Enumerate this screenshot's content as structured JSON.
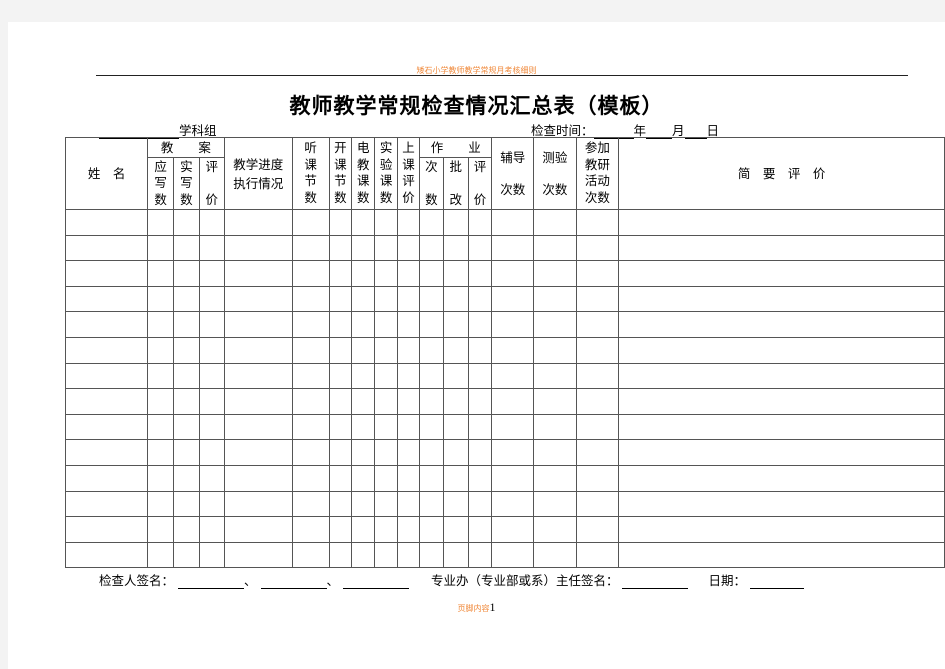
{
  "header_text": "矮石小学教师教学常规月考核细则",
  "title": "教师教学常规检查情况汇总表（模板）",
  "subject_group_label": "学科组",
  "check_time": {
    "label": "检查时间：",
    "year": "年",
    "month": "月",
    "day": "日"
  },
  "table": {
    "headers": {
      "name": "姓　名",
      "lesson_plan": "教　　案",
      "lesson_plan_sub": [
        {
          "chars": [
            "应",
            "写",
            "数"
          ]
        },
        {
          "chars": [
            "实",
            "写",
            "数"
          ]
        },
        {
          "chars": [
            "评",
            "",
            "价"
          ]
        }
      ],
      "progress": [
        "教学进度",
        "执行情况"
      ],
      "listen": [
        "听",
        "课",
        "节",
        "数"
      ],
      "open": [
        "开",
        "课",
        "节",
        "数"
      ],
      "electronic": [
        "电",
        "教",
        "课",
        "数"
      ],
      "experiment": [
        "实",
        "验",
        "课",
        "数"
      ],
      "class_eval": [
        "上",
        "课",
        "评",
        "价"
      ],
      "homework": "作　　业",
      "homework_sub": [
        {
          "chars": [
            "次",
            "",
            "数"
          ]
        },
        {
          "chars": [
            "批",
            "",
            "改"
          ]
        },
        {
          "chars": [
            "评",
            "",
            "价"
          ]
        }
      ],
      "tutoring": [
        "辅导",
        "次数"
      ],
      "tests": [
        "测验",
        "次数"
      ],
      "research": [
        "参加",
        "教研",
        "活动",
        "次数"
      ],
      "brief_eval": "简　要　评　价"
    },
    "row_count": 14,
    "rows": [
      [
        "",
        "",
        "",
        "",
        "",
        "",
        "",
        "",
        "",
        "",
        "",
        "",
        "",
        "",
        "",
        "",
        ""
      ],
      [
        "",
        "",
        "",
        "",
        "",
        "",
        "",
        "",
        "",
        "",
        "",
        "",
        "",
        "",
        "",
        "",
        ""
      ],
      [
        "",
        "",
        "",
        "",
        "",
        "",
        "",
        "",
        "",
        "",
        "",
        "",
        "",
        "",
        "",
        "",
        ""
      ],
      [
        "",
        "",
        "",
        "",
        "",
        "",
        "",
        "",
        "",
        "",
        "",
        "",
        "",
        "",
        "",
        "",
        ""
      ],
      [
        "",
        "",
        "",
        "",
        "",
        "",
        "",
        "",
        "",
        "",
        "",
        "",
        "",
        "",
        "",
        "",
        ""
      ],
      [
        "",
        "",
        "",
        "",
        "",
        "",
        "",
        "",
        "",
        "",
        "",
        "",
        "",
        "",
        "",
        "",
        ""
      ],
      [
        "",
        "",
        "",
        "",
        "",
        "",
        "",
        "",
        "",
        "",
        "",
        "",
        "",
        "",
        "",
        "",
        ""
      ],
      [
        "",
        "",
        "",
        "",
        "",
        "",
        "",
        "",
        "",
        "",
        "",
        "",
        "",
        "",
        "",
        "",
        ""
      ],
      [
        "",
        "",
        "",
        "",
        "",
        "",
        "",
        "",
        "",
        "",
        "",
        "",
        "",
        "",
        "",
        "",
        ""
      ],
      [
        "",
        "",
        "",
        "",
        "",
        "",
        "",
        "",
        "",
        "",
        "",
        "",
        "",
        "",
        "",
        "",
        ""
      ],
      [
        "",
        "",
        "",
        "",
        "",
        "",
        "",
        "",
        "",
        "",
        "",
        "",
        "",
        "",
        "",
        "",
        ""
      ],
      [
        "",
        "",
        "",
        "",
        "",
        "",
        "",
        "",
        "",
        "",
        "",
        "",
        "",
        "",
        "",
        "",
        ""
      ],
      [
        "",
        "",
        "",
        "",
        "",
        "",
        "",
        "",
        "",
        "",
        "",
        "",
        "",
        "",
        "",
        "",
        ""
      ],
      [
        "",
        "",
        "",
        "",
        "",
        "",
        "",
        "",
        "",
        "",
        "",
        "",
        "",
        "",
        "",
        "",
        ""
      ]
    ]
  },
  "signatures": {
    "inspector_label": "检查人签名：",
    "separator": "、",
    "director_label": "专业办（专业部或系）主任签名：",
    "date_label": "日期："
  },
  "page_footer": {
    "label": "页脚内容",
    "page_number": "1"
  }
}
